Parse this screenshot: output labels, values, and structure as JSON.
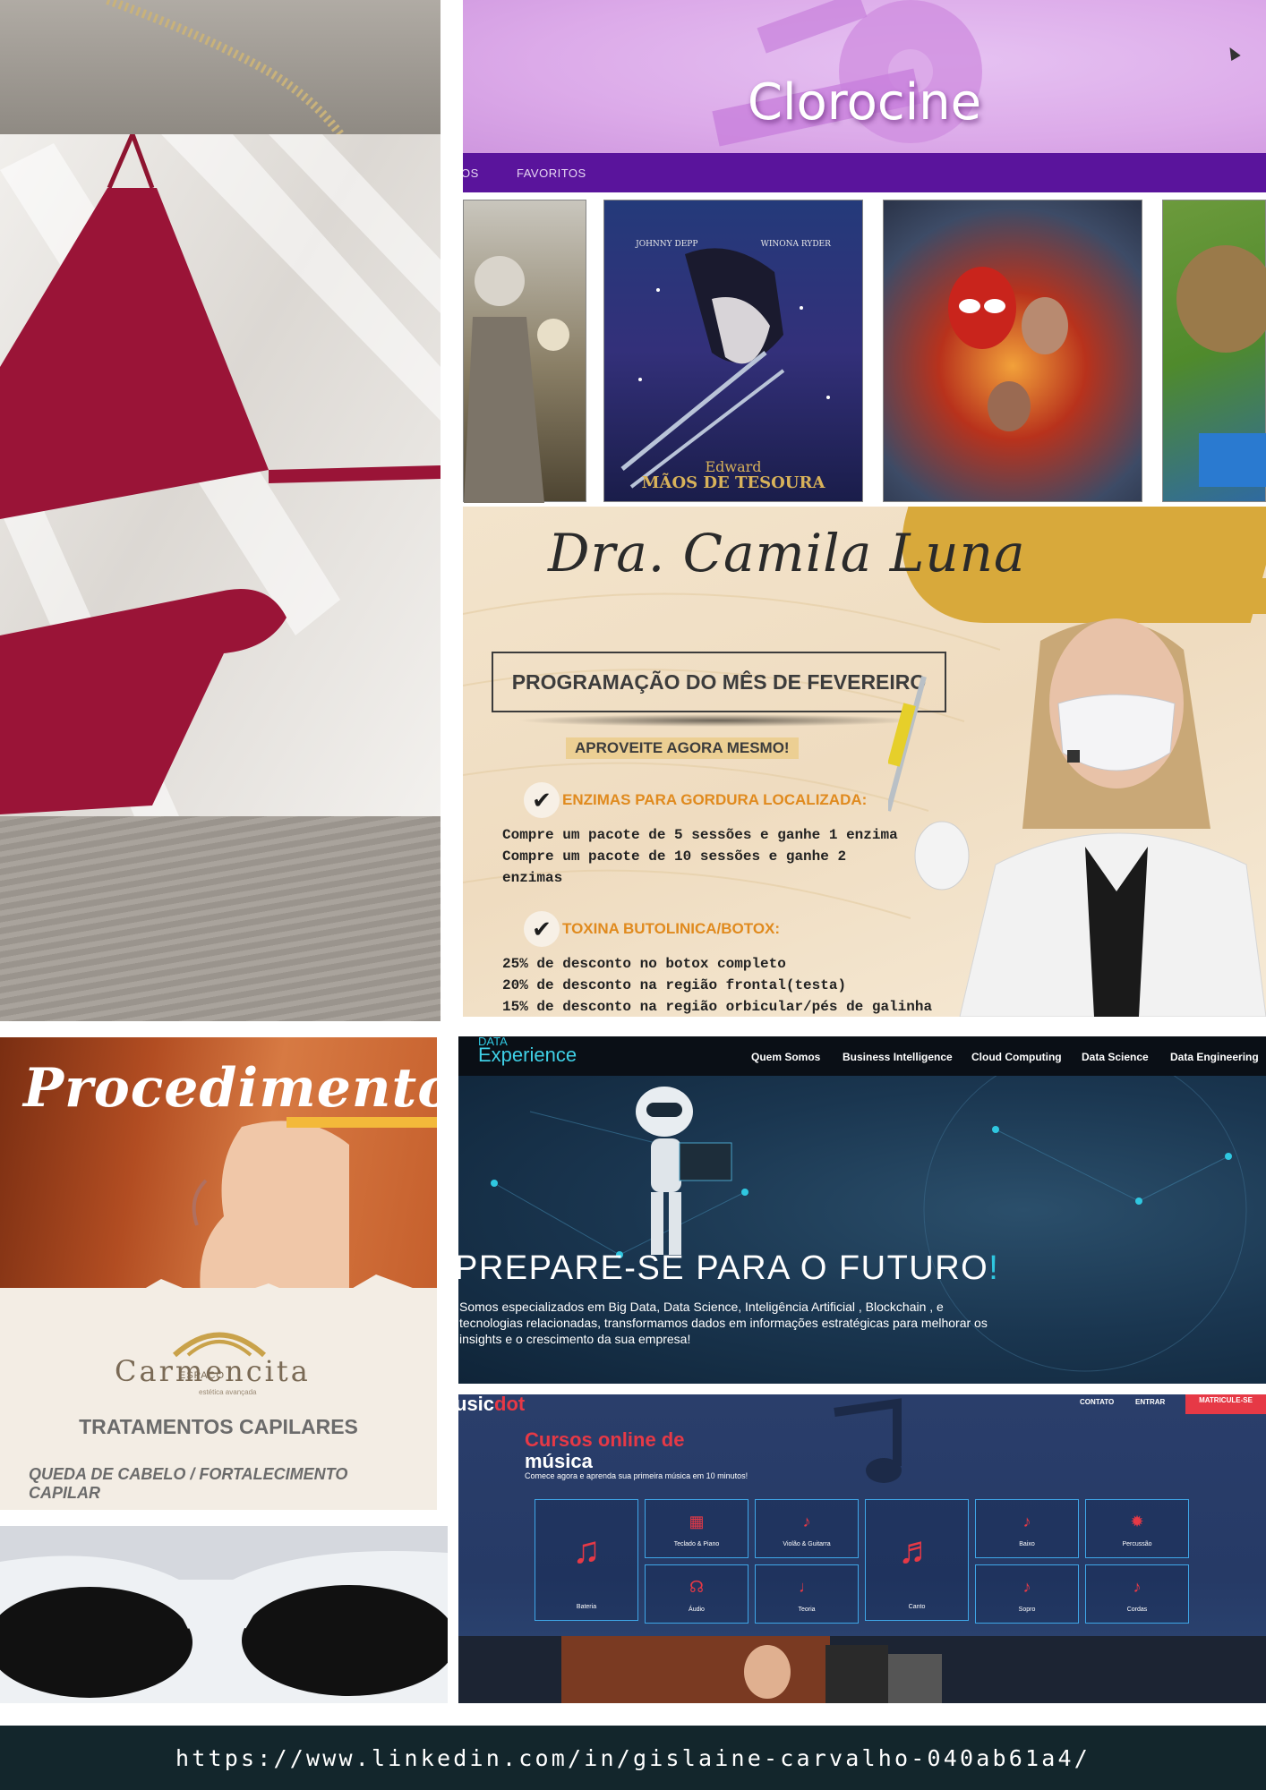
{
  "bikini": {
    "alt_icon": "bikini-photo"
  },
  "clorocine": {
    "title": "Clorocine",
    "nav": {
      "item1": "OS",
      "item2": "FAVORITOS"
    },
    "posters": {
      "p2": {
        "actor1": "JOHNNY DEPP",
        "actor2": "WINONA RYDER",
        "title1": "Edward",
        "title2": "MÃOS DE TESOURA"
      }
    },
    "colors": {
      "banner": "#dcaae9",
      "nav": "#5a149c"
    }
  },
  "camila": {
    "signature": "Dra. Camila Luna",
    "box": "PROGRAMAÇÃO DO MÊS DE FEVEREIRO",
    "aproveite": "APROVEITE AGORA MESMO!",
    "section1": {
      "heading": "ENZIMAS PARA GORDURA LOCALIZADA:",
      "lines": [
        "Compre um pacote de 5 sessões e ganhe 1 enzima",
        "Compre um pacote de 10 sessões  e ganhe 2",
        "enzimas"
      ]
    },
    "section2": {
      "heading": "TOXINA BUTOLINICA/BOTOX:",
      "lines": [
        "25% de desconto no botox completo",
        "20% de desconto na região frontal(testa)",
        "15% de desconto na região orbicular/pés de galinha"
      ]
    },
    "check": "✔"
  },
  "procedimentos": {
    "title": "Procedimentos",
    "logo_small": "ESPAÇO",
    "logo": "Carmencita",
    "logo_sub": "estética avançada",
    "heading": "TRATAMENTOS CAPILARES",
    "sub": "QUEDA DE CABELO / FORTALECIMENTO CAPILAR"
  },
  "data_exp": {
    "logo_small": "DATA",
    "logo": "Experience",
    "nav": [
      "Quem Somos",
      "Business Intelligence",
      "Cloud Computing",
      "Data Science",
      "Data Engineering"
    ],
    "headline": "PREPARE-SE PARA O FUTURO",
    "bang": "!",
    "para": "Somos especializados em Big Data, Data Science, Inteligência Artificial , Blockchain , e tecnologias relacionadas, transformamos dados em informações estratégicas para melhorar os insights e o crescimento da sua empresa!"
  },
  "music": {
    "logo": "usic",
    "logo_dot": "dot",
    "nav": [
      "CONTATO",
      "ENTRAR"
    ],
    "cta": "MATRICULE-SE",
    "title1": "Cursos online de",
    "title2": "música",
    "sub": "Comece agora e aprenda sua primeira música em 10 minutos!",
    "cards": [
      "Bateria",
      "Teclado & Piano",
      "Violão & Guitarra",
      "Canto",
      "Baixo",
      "Percussão",
      "Áudio",
      "Teoria",
      "Sopro",
      "Cordas"
    ],
    "accent": "#e63946"
  },
  "footer": {
    "url": "https://www.linkedin.com/in/gislaine-carvalho-040ab61a4/"
  }
}
